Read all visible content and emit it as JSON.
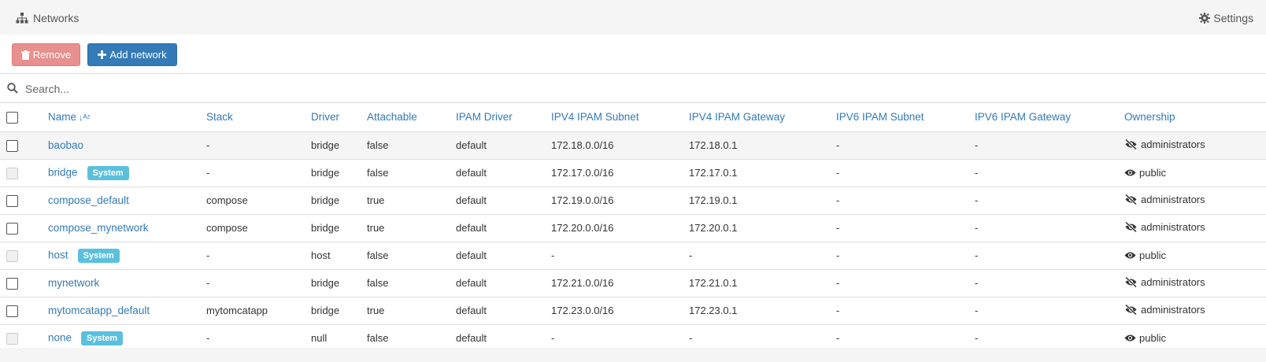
{
  "header": {
    "title": "Networks",
    "settings_label": "Settings"
  },
  "toolbar": {
    "remove_label": "Remove",
    "add_label": "Add network"
  },
  "search": {
    "placeholder": "Search..."
  },
  "columns": [
    "Name",
    "Stack",
    "Driver",
    "Attachable",
    "IPAM Driver",
    "IPV4 IPAM Subnet",
    "IPV4 IPAM Gateway",
    "IPV6 IPAM Subnet",
    "IPV6 IPAM Gateway",
    "Ownership"
  ],
  "rows": [
    {
      "name": "baobao",
      "system": false,
      "stack": "-",
      "driver": "bridge",
      "attachable": "false",
      "ipam_driver": "default",
      "ipv4_subnet": "172.18.0.0/16",
      "ipv4_gateway": "172.18.0.1",
      "ipv6_subnet": "-",
      "ipv6_gateway": "-",
      "ownership": "administrators",
      "ownership_icon": "eye-slash-icon"
    },
    {
      "name": "bridge",
      "system": true,
      "badge": "System",
      "stack": "-",
      "driver": "bridge",
      "attachable": "false",
      "ipam_driver": "default",
      "ipv4_subnet": "172.17.0.0/16",
      "ipv4_gateway": "172.17.0.1",
      "ipv6_subnet": "-",
      "ipv6_gateway": "-",
      "ownership": "public",
      "ownership_icon": "eye-icon"
    },
    {
      "name": "compose_default",
      "system": false,
      "stack": "compose",
      "driver": "bridge",
      "attachable": "true",
      "ipam_driver": "default",
      "ipv4_subnet": "172.19.0.0/16",
      "ipv4_gateway": "172.19.0.1",
      "ipv6_subnet": "-",
      "ipv6_gateway": "-",
      "ownership": "administrators",
      "ownership_icon": "eye-slash-icon"
    },
    {
      "name": "compose_mynetwork",
      "system": false,
      "stack": "compose",
      "driver": "bridge",
      "attachable": "true",
      "ipam_driver": "default",
      "ipv4_subnet": "172.20.0.0/16",
      "ipv4_gateway": "172.20.0.1",
      "ipv6_subnet": "-",
      "ipv6_gateway": "-",
      "ownership": "administrators",
      "ownership_icon": "eye-slash-icon"
    },
    {
      "name": "host",
      "system": true,
      "badge": "System",
      "stack": "-",
      "driver": "host",
      "attachable": "false",
      "ipam_driver": "default",
      "ipv4_subnet": "-",
      "ipv4_gateway": "-",
      "ipv6_subnet": "-",
      "ipv6_gateway": "-",
      "ownership": "public",
      "ownership_icon": "eye-icon"
    },
    {
      "name": "mynetwork",
      "system": false,
      "stack": "-",
      "driver": "bridge",
      "attachable": "false",
      "ipam_driver": "default",
      "ipv4_subnet": "172.21.0.0/16",
      "ipv4_gateway": "172.21.0.1",
      "ipv6_subnet": "-",
      "ipv6_gateway": "-",
      "ownership": "administrators",
      "ownership_icon": "eye-slash-icon"
    },
    {
      "name": "mytomcatapp_default",
      "system": false,
      "stack": "mytomcatapp",
      "driver": "bridge",
      "attachable": "true",
      "ipam_driver": "default",
      "ipv4_subnet": "172.23.0.0/16",
      "ipv4_gateway": "172.23.0.1",
      "ipv6_subnet": "-",
      "ipv6_gateway": "-",
      "ownership": "administrators",
      "ownership_icon": "eye-slash-icon"
    },
    {
      "name": "none",
      "system": true,
      "badge": "System",
      "stack": "-",
      "driver": "null",
      "attachable": "false",
      "ipam_driver": "default",
      "ipv4_subnet": "-",
      "ipv4_gateway": "-",
      "ipv6_subnet": "-",
      "ipv6_gateway": "-",
      "ownership": "public",
      "ownership_icon": "eye-icon"
    }
  ],
  "colors": {
    "link": "#337ab7",
    "badge": "#5bc0de",
    "remove_btn": "#e7908e",
    "add_btn": "#337ab7"
  }
}
